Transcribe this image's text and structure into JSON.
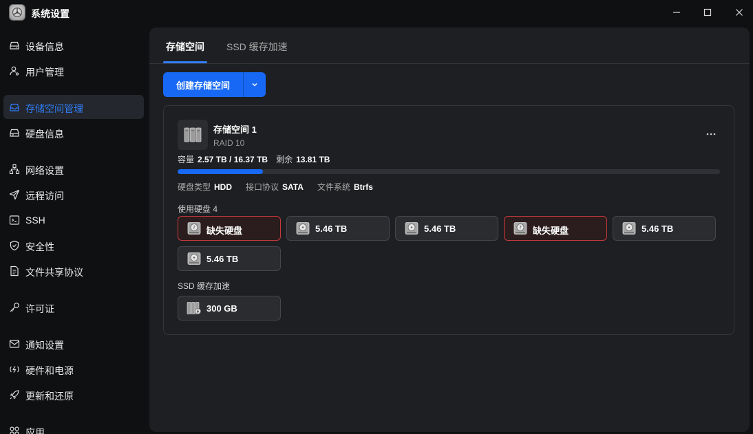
{
  "window": {
    "title": "系统设置",
    "controls": {
      "minimize": "minimize-icon",
      "maximize": "maximize-icon",
      "close": "close-icon"
    }
  },
  "sidebar": {
    "items": [
      {
        "label": "设备信息",
        "icon": "device-icon"
      },
      {
        "label": "用户管理",
        "icon": "user-icon"
      },
      {
        "label": "存储空间管理",
        "icon": "storage-icon",
        "active": true
      },
      {
        "label": "硬盘信息",
        "icon": "disk-icon"
      },
      {
        "label": "网络设置",
        "icon": "network-icon"
      },
      {
        "label": "远程访问",
        "icon": "send-icon"
      },
      {
        "label": "SSH",
        "icon": "terminal-icon"
      },
      {
        "label": "安全性",
        "icon": "shield-icon"
      },
      {
        "label": "文件共享协议",
        "icon": "file-icon"
      },
      {
        "label": "许可证",
        "icon": "key-icon"
      },
      {
        "label": "通知设置",
        "icon": "mail-icon"
      },
      {
        "label": "硬件和电源",
        "icon": "power-icon"
      },
      {
        "label": "更新和还原",
        "icon": "rocket-icon"
      },
      {
        "label": "应用",
        "icon": "apps-icon"
      }
    ]
  },
  "tabs": [
    {
      "label": "存储空间",
      "active": true
    },
    {
      "label": "SSD 缓存加速",
      "active": false
    }
  ],
  "toolbar": {
    "create_label": "创建存储空间"
  },
  "pool": {
    "name": "存储空间 1",
    "raid": "RAID 10",
    "capacity_label": "容量",
    "capacity_value": "2.57 TB / 16.37 TB",
    "remaining_label": "剩余",
    "remaining_value": "13.81 TB",
    "usage_fraction": 0.157,
    "disk_type_label": "硬盘类型",
    "disk_type_value": "HDD",
    "interface_label": "接口协议",
    "interface_value": "SATA",
    "fs_label": "文件系统",
    "fs_value": "Btrfs",
    "used_disks_label": "使用硬盘 4",
    "disks": [
      {
        "label": "缺失硬盘",
        "status": "missing"
      },
      {
        "label": "5.46 TB",
        "status": "ok"
      },
      {
        "label": "5.46 TB",
        "status": "ok"
      },
      {
        "label": "缺失硬盘",
        "status": "missing"
      },
      {
        "label": "5.46 TB",
        "status": "ok"
      },
      {
        "label": "5.46 TB",
        "status": "ok"
      }
    ],
    "ssd_label": "SSD 缓存加速",
    "ssd_disk": {
      "label": "300 GB"
    }
  },
  "colors": {
    "accent": "#1769f5",
    "missing_border": "#c8393c"
  }
}
